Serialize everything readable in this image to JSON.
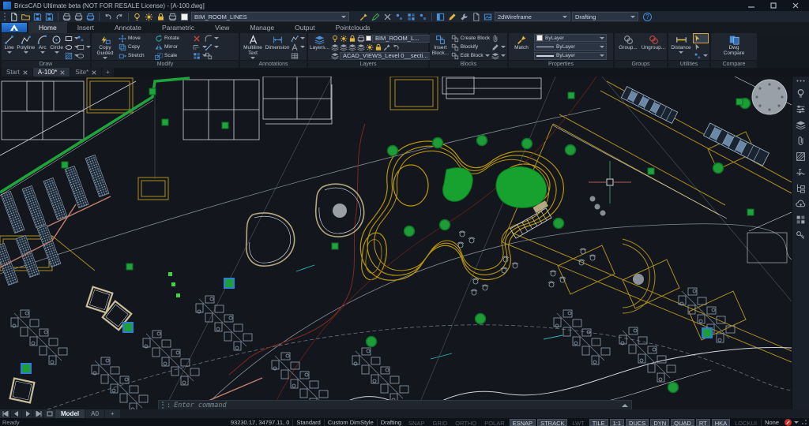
{
  "title_bar": {
    "title": "BricsCAD Ultimate beta (NOT FOR RESALE License) - [A-100.dwg]"
  },
  "quick_toolbar": {
    "icons_left": [
      "new-file-icon",
      "open-folder-icon",
      "save-icon",
      "save-as-icon",
      "plot-icon",
      "print-preview-icon",
      "publish-icon",
      "undo-icon",
      "redo-icon"
    ],
    "layer_controls": [
      "layer-on-icon",
      "layer-freeze-icon",
      "layer-lock-icon",
      "layer-plot-icon",
      "color-swatch-white"
    ],
    "layer_combo_value": "BIM_ROOM_LINES",
    "mid_icons": [
      "match-properties-icon",
      "color-picker-icon",
      "explode-icon",
      "copy-nested-icon",
      "selection-modes-icon",
      "quad-icon"
    ],
    "right_icons": [
      "panels-icon",
      "draw-order-icon",
      "settings-icon",
      "script-icon",
      "render-icon"
    ],
    "view_combo_value": "2dWireframe",
    "workspace_combo_value": "Drafting",
    "help_glyph": "?"
  },
  "ribbon": {
    "tabs": [
      {
        "label": "Home",
        "active": true
      },
      {
        "label": "Insert"
      },
      {
        "label": "Annotate"
      },
      {
        "label": "Parametric"
      },
      {
        "label": "View"
      },
      {
        "label": "Manage"
      },
      {
        "label": "Output"
      },
      {
        "label": "Pointclouds"
      }
    ],
    "panels": {
      "draw": {
        "label": "Draw",
        "buttons": [
          "Line",
          "Polyline",
          "Arc",
          "Circle"
        ]
      },
      "modify": {
        "label": "Modify",
        "big_button": "Copy Guided",
        "buttons": [
          "Move",
          "Rotate",
          "Copy",
          "Mirror",
          "Stretch",
          "Scale"
        ]
      },
      "annotations": {
        "label": "Annotations",
        "buttons": [
          "Multiline Text",
          "Dimension"
        ]
      },
      "layers": {
        "label": "Layers",
        "big_button": "Layers...",
        "layer_combo": "BIM_ROOM_L...",
        "view_combo": "ACAD_VIEWS_Level 0__secti..."
      },
      "blocks": {
        "label": "Blocks",
        "big_button": "Insert Block...",
        "buttons": [
          "Create Block",
          "Blockify",
          "Edit Block"
        ]
      },
      "properties": {
        "label": "Properties",
        "big_button": "Match",
        "combos": [
          "ByLayer",
          "ByLayer",
          "ByLayer"
        ]
      },
      "groups": {
        "label": "Groups",
        "buttons": [
          "Group...",
          "Ungroup..."
        ]
      },
      "utilities": {
        "label": "Utilities",
        "big_button": "Distance"
      },
      "compare": {
        "label": "Compare",
        "big_button": "Dwg Compare"
      }
    }
  },
  "document_tabs": {
    "tabs": [
      {
        "label": "Start"
      },
      {
        "label": "A-100*",
        "active": true
      },
      {
        "label": "Site*"
      }
    ],
    "new_tab": "+"
  },
  "sidebar_icons": [
    "more-icon",
    "tips-icon",
    "properties-panel-icon",
    "layers-panel-icon",
    "attachments-icon",
    "hatch-panel-icon",
    "parameters-icon",
    "structure-icon",
    "cloud-icon",
    "components-icon",
    "hotkey-icon"
  ],
  "command_bar": {
    "prompt": ":",
    "placeholder": "Enter command"
  },
  "layout_bar": {
    "tabs": [
      {
        "label": "Model",
        "active": true
      },
      {
        "label": "A0"
      }
    ],
    "new_tab": "+"
  },
  "status_bar": {
    "left": "Ready",
    "coords": "93230.17, 34797.11, 0",
    "fields": [
      "Standard",
      "Custom DimStyle",
      "Drafting"
    ],
    "toggles": [
      {
        "label": "SNAP",
        "on": false
      },
      {
        "label": "GRID",
        "on": false
      },
      {
        "label": "ORTHO",
        "on": false
      },
      {
        "label": "POLAR",
        "on": false
      },
      {
        "label": "ESNAP",
        "on": true
      },
      {
        "label": "STRACK",
        "on": true
      },
      {
        "label": "LWT",
        "on": false
      },
      {
        "label": "TILE",
        "on": true
      },
      {
        "label": "1:1",
        "on": true
      },
      {
        "label": "DUCS",
        "on": true
      },
      {
        "label": "DYN",
        "on": true
      },
      {
        "label": "QUAD",
        "on": true
      },
      {
        "label": "RT",
        "on": true
      },
      {
        "label": "HKA",
        "on": true
      },
      {
        "label": "LOCKUI",
        "on": false
      }
    ],
    "selection": "None"
  },
  "colors": {
    "accent_blue": "#2f7fd6",
    "canvas_bg": "#13161c",
    "marker_green": "#1fa43c",
    "contour_yellow": "#b8960c",
    "wall_white": "#cfd4da",
    "red_line": "#7d2a1e",
    "salmon": "#c08070",
    "hatch_blue": "#9db6cc",
    "toggle_on_bg": "#343c48"
  }
}
